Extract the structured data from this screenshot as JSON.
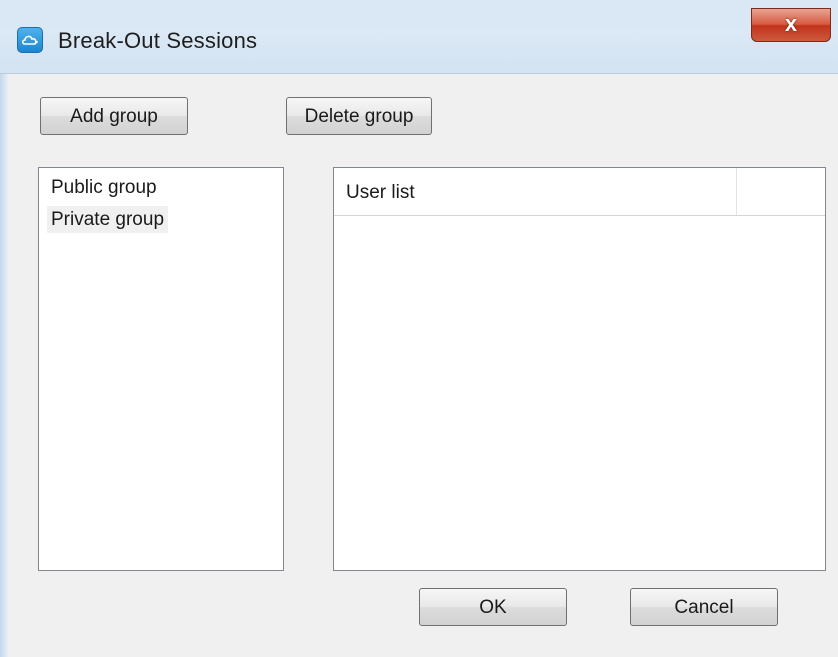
{
  "window": {
    "title": "Break-Out Sessions",
    "close_label": "x"
  },
  "toolbar": {
    "add_group_label": "Add group",
    "delete_group_label": "Delete group"
  },
  "groups": [
    {
      "label": "Public group",
      "selected": false
    },
    {
      "label": "Private group",
      "selected": true
    }
  ],
  "user_list": {
    "columns": [
      "User list",
      ""
    ],
    "rows": []
  },
  "footer": {
    "ok_label": "OK",
    "cancel_label": "Cancel"
  },
  "colors": {
    "titlebar": "#d9e7f5",
    "close_button": "#c1331b",
    "app_icon": "#1d86cf",
    "dialog_background": "#f0f0f0"
  }
}
